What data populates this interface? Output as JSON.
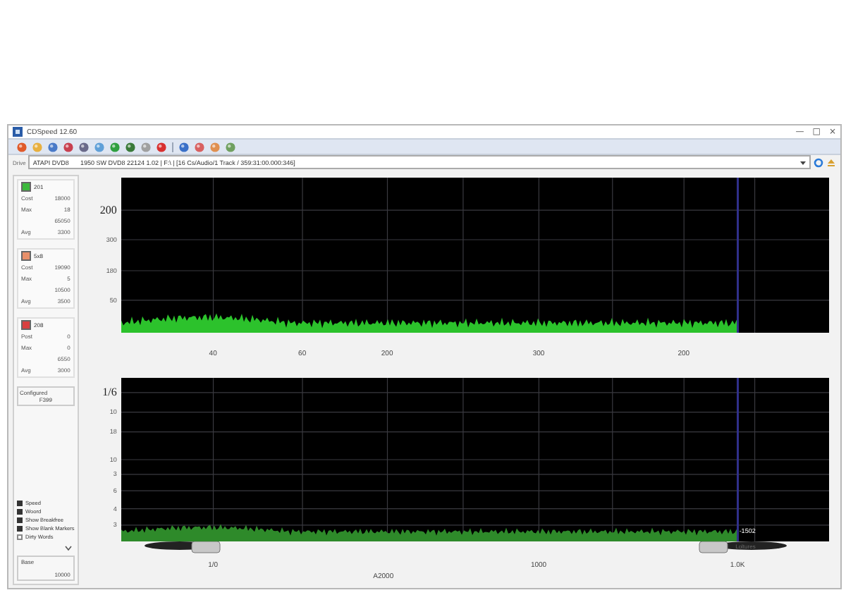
{
  "window": {
    "title": "CDSpeed 12.60",
    "controls": [
      "—",
      "□",
      "×"
    ]
  },
  "drive": {
    "label": "Drive",
    "value": "ATAPI DVD8",
    "info": "1950 SW DVD8 22124 1.02 | F:\\ | [16 Cs/Audio/1 Track / 359:31:00.000:346]"
  },
  "groups": [
    {
      "title": "201",
      "color": "#3cb83c",
      "rows": [
        {
          "label": "Cost",
          "value": "18000"
        },
        {
          "label": "Max",
          "value": "18"
        },
        {
          "value": "65050"
        },
        {
          "label": "Avg",
          "value": "3300"
        }
      ]
    },
    {
      "title": "5x8",
      "color": "#e8906a",
      "rows": [
        {
          "label": "Cost",
          "value": "19090"
        },
        {
          "label": "Max",
          "value": "5"
        },
        {
          "value": "10500"
        },
        {
          "label": "Avg",
          "value": "3500"
        }
      ]
    },
    {
      "title": "208",
      "color": "#d84040",
      "rows": [
        {
          "label": "Post",
          "value": "0"
        },
        {
          "label": "Max",
          "value": "0"
        },
        {
          "value": "6550"
        },
        {
          "label": "Avg",
          "value": "3000"
        }
      ]
    }
  ],
  "configured": {
    "label": "Configured",
    "value": "F399"
  },
  "options": [
    {
      "label": "Speed",
      "checked": true
    },
    {
      "label": "Woord",
      "checked": true
    },
    {
      "label": "Show Breakfree",
      "checked": true
    },
    {
      "label": "Show Blank Markers",
      "checked": true
    },
    {
      "label": "Dirty Words",
      "checked": false
    }
  ],
  "base": {
    "label": "Base",
    "value": "10000"
  },
  "charts": [
    {
      "y_ticks": [
        "200",
        "300",
        "180",
        "50"
      ],
      "x_ticks": [
        "40",
        "60",
        "200",
        "300",
        "200"
      ]
    },
    {
      "y_ticks": [
        "1/6",
        "10",
        "18",
        "10",
        "3",
        "6",
        "4",
        "3"
      ],
      "x_ticks": [
        "1/0",
        "1000",
        "1.0K"
      ],
      "x_title": "A2000",
      "marker": "-1502",
      "marker_note": "Loltures"
    }
  ]
}
